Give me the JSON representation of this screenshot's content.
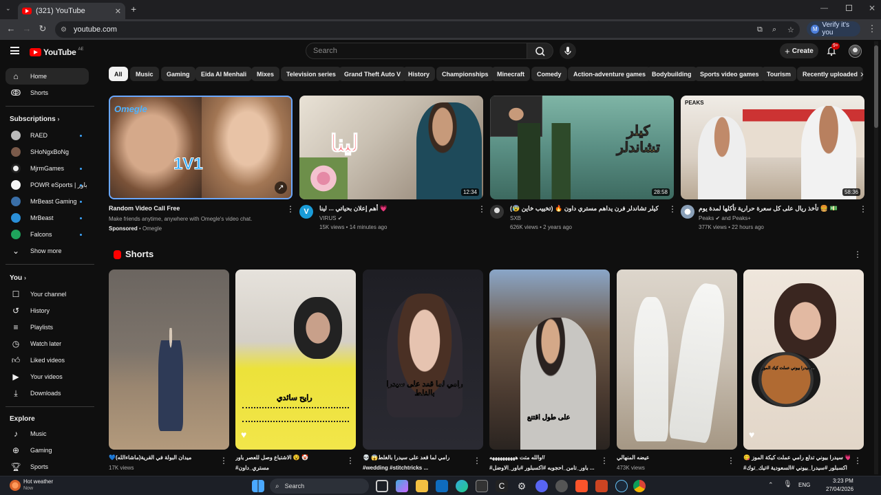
{
  "browser": {
    "tab_title": "(321) YouTube",
    "url": "youtube.com",
    "profile_label": "Verify it's you",
    "profile_initial": "M"
  },
  "header": {
    "logo_text": "YouTube",
    "region": "AE",
    "search_placeholder": "Search",
    "create_label": "Create",
    "notif_count": "9+"
  },
  "sidebar": {
    "main": [
      {
        "label": "Home",
        "icon": "home-icon"
      },
      {
        "label": "Shorts",
        "icon": "shorts-icon"
      }
    ],
    "subscriptions_title": "Subscriptions",
    "subscriptions": [
      "RAED",
      "SHoNgxBoNg",
      "MjrmGames",
      "POWR eSports | باور",
      "MrBeast Gaming",
      "MrBeast",
      "Falcons"
    ],
    "show_more": "Show more",
    "you_title": "You",
    "you": [
      "Your channel",
      "History",
      "Playlists",
      "Watch later",
      "Liked videos",
      "Your videos",
      "Downloads"
    ],
    "explore_title": "Explore",
    "explore": [
      "Music",
      "Gaming",
      "Sports"
    ]
  },
  "chips": [
    "All",
    "Music",
    "Gaming",
    "Eida Al Menhali",
    "Mixes",
    "Television series",
    "Grand Theft Auto V",
    "History",
    "Championships",
    "Minecraft",
    "Comedy",
    "Action-adventure games",
    "Bodybuilding",
    "Sports video games",
    "Tourism",
    "Recently uploaded"
  ],
  "videos": [
    {
      "title": "Random Video Call Free",
      "line2": "Make friends anytime, anywhere with Omegle's video chat.",
      "line3_a": "Sponsored",
      "line3_b": " • Omegle",
      "duration": "",
      "thumb_text": "1V1",
      "brand": "Omegle"
    },
    {
      "title": "أهم إعلان بحياتي ... لينا 💗",
      "channel": "VIRUS",
      "meta": "15K views • 14 minutes ago",
      "duration": "12:34",
      "thumb_text": "لينا"
    },
    {
      "title": "(😰 تخييب خاين) 🔥 كيلر تشاندلر فرن يداهم مستري داون",
      "channel": "SXB",
      "meta": "626K views • 2 years ago",
      "duration": "28:58",
      "thumb_text": "كيلر تشاندلر"
    },
    {
      "title": "تأخذ ريال على كل سعرة حرارية تأكلها لمدة يوم 🍔 💵",
      "channel": "Peaks",
      "channel_extra": "and Peaks+",
      "meta": "377K views • 22 hours ago",
      "duration": "58:36",
      "thumb_text": "PEAKS"
    }
  ],
  "shorts_title": "Shorts",
  "shorts": [
    {
      "title": "💙ميدان البولة في القرية(ماشاءالله)",
      "views": "17K views",
      "overlay": ""
    },
    {
      "title": "الاشتباع وصل للعصر باور 😵 🤡",
      "title2": "#مستري_داون",
      "views": "",
      "overlay": "رايح سائدي"
    },
    {
      "title": "💀 😱رامي لما قعد على سيدرا بالغلط",
      "title2": "#wedding #stitchtricks ...",
      "views": "",
      "overlay": "رامي لما قعد على سيدرا بالغلط"
    },
    {
      "title": "والله متت ههههههههههه//",
      "title2": "#باور_تامن_احجوبه #اكسبلور #باور_الاوضل ...",
      "views": "",
      "overlay": "على طول اقتنع"
    },
    {
      "title": "عيضه المنهالي",
      "views": "473K views",
      "overlay": ""
    },
    {
      "title": "😋 سيدرا بيوني تدلع رامي عملت كيكة الموز 💗",
      "title2": "#اكسبلور #سيدرا_بيوني #السعودية #تيك_توك",
      "views": "",
      "overlay": "سيدرا بيوني عملت كيك الموز..."
    }
  ],
  "taskbar": {
    "weather_title": "Hot weather",
    "weather_sub": "Now",
    "search_label": "Search",
    "lang": "ENG",
    "time": "3:23 PM",
    "date": "27/04/2026"
  }
}
